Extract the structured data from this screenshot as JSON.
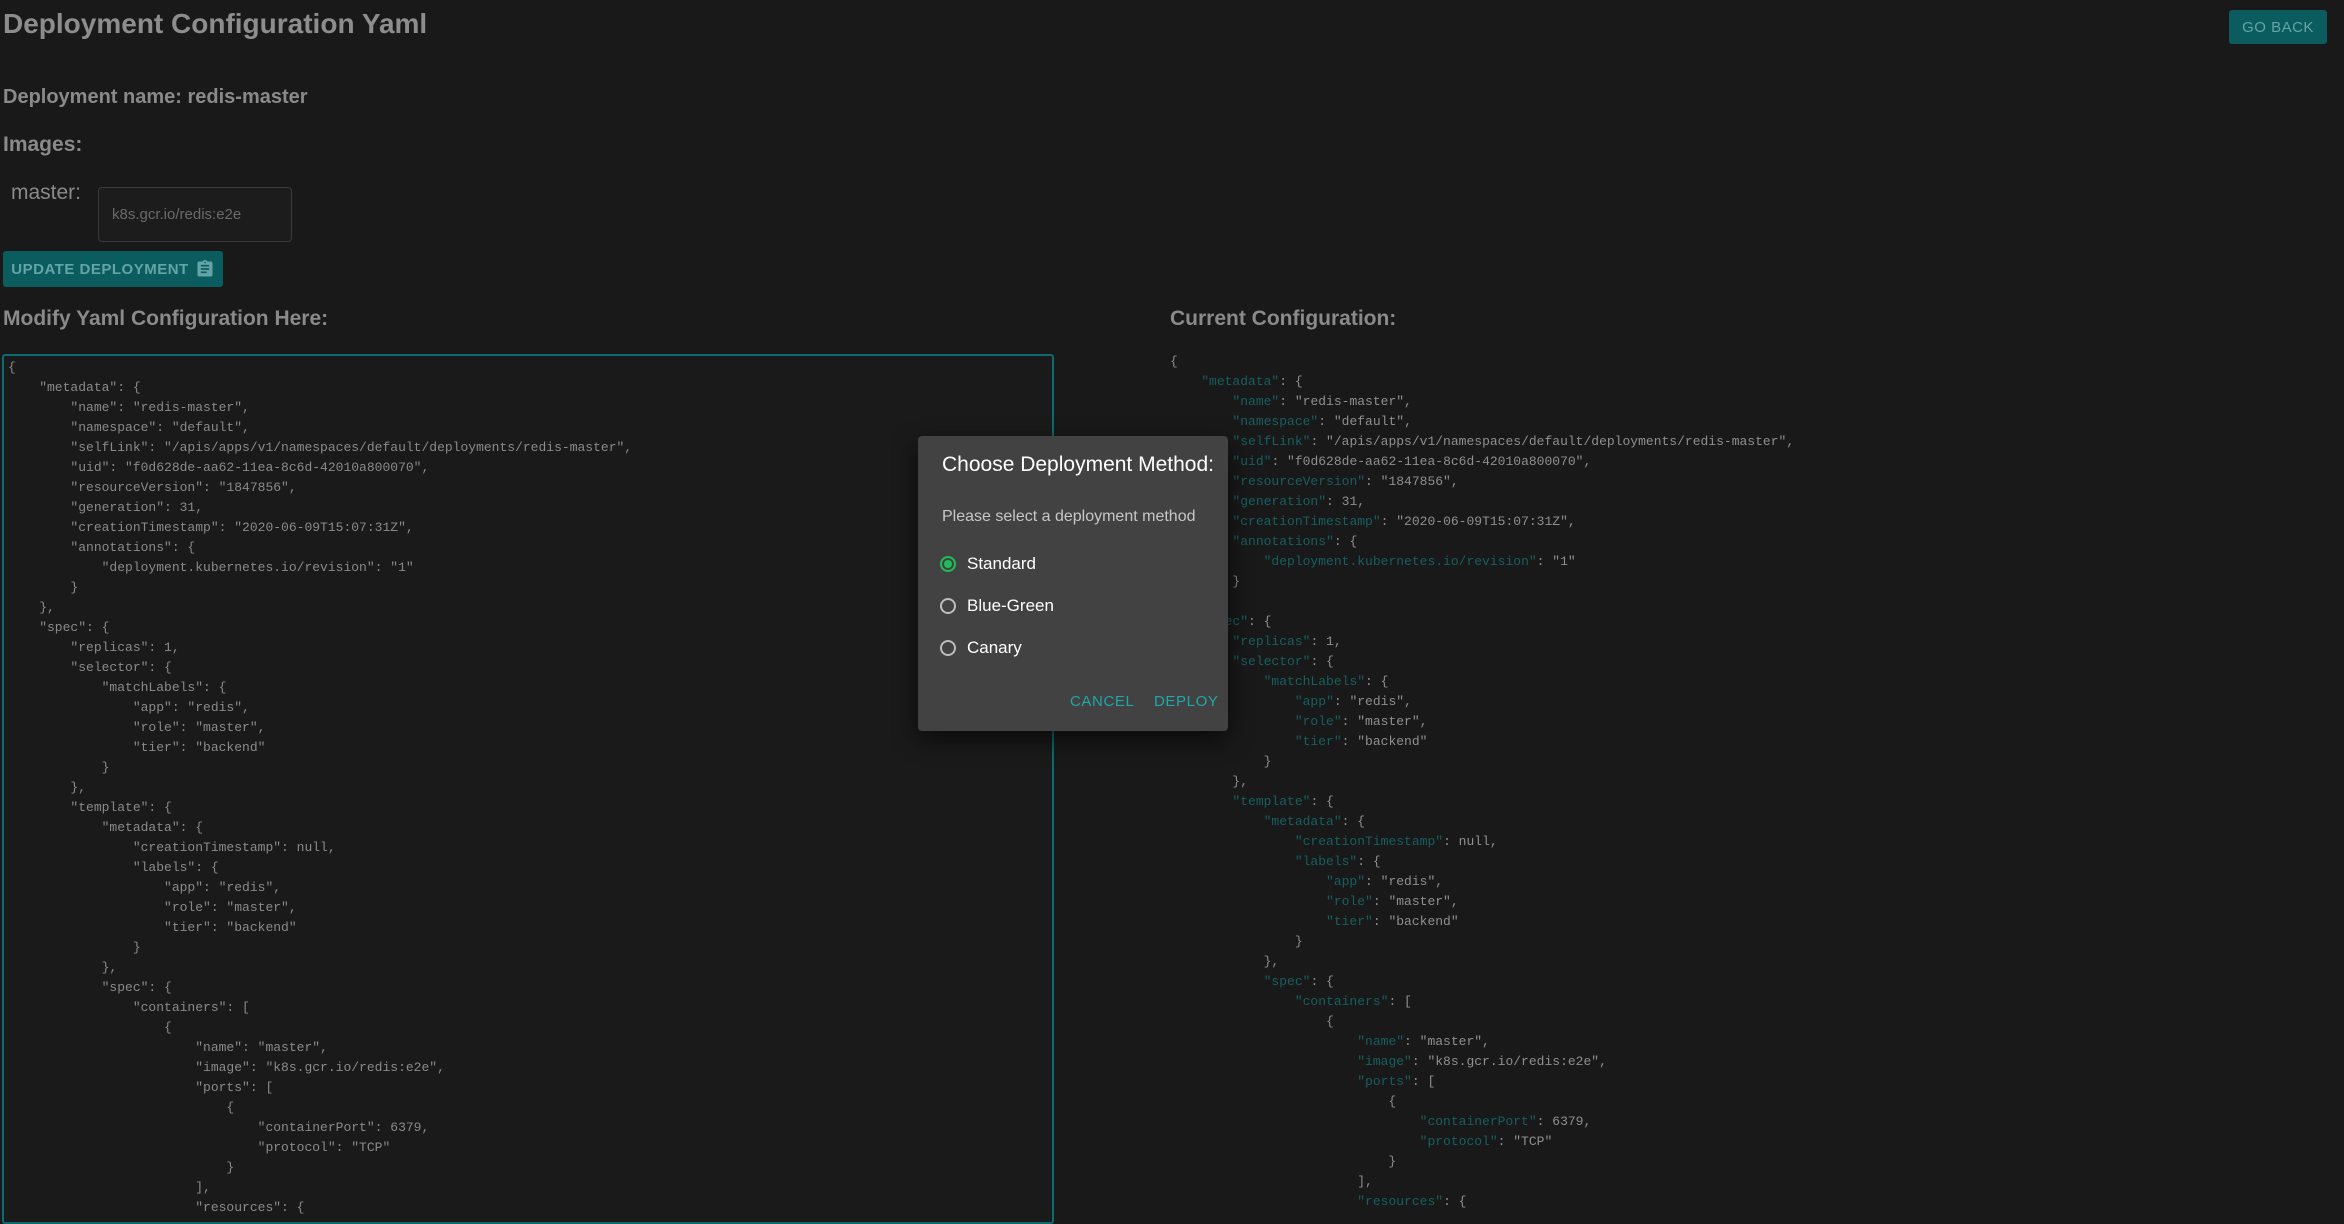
{
  "header": {
    "title": "Deployment Configuration Yaml",
    "go_back_label": "GO BACK"
  },
  "deployment": {
    "name_line": "Deployment name: redis-master",
    "images_heading": "Images:"
  },
  "image_field": {
    "label": "master:",
    "value": "k8s.gcr.io/redis:e2e"
  },
  "update_button": {
    "label": "UPDATE DEPLOYMENT",
    "icon": "clipboard-icon"
  },
  "editor": {
    "heading": "Modify Yaml Configuration Here:"
  },
  "current": {
    "heading": "Current Configuration:"
  },
  "yaml_lines": [
    "{",
    "    \"metadata\": {",
    "        \"name\": \"redis-master\",",
    "        \"namespace\": \"default\",",
    "        \"selfLink\": \"/apis/apps/v1/namespaces/default/deployments/redis-master\",",
    "        \"uid\": \"f0d628de-aa62-11ea-8c6d-42010a800070\",",
    "        \"resourceVersion\": \"1847856\",",
    "        \"generation\": 31,",
    "        \"creationTimestamp\": \"2020-06-09T15:07:31Z\",",
    "        \"annotations\": {",
    "            \"deployment.kubernetes.io/revision\": \"1\"",
    "        }",
    "    },",
    "    \"spec\": {",
    "        \"replicas\": 1,",
    "        \"selector\": {",
    "            \"matchLabels\": {",
    "                \"app\": \"redis\",",
    "                \"role\": \"master\",",
    "                \"tier\": \"backend\"",
    "            }",
    "        },",
    "        \"template\": {",
    "            \"metadata\": {",
    "                \"creationTimestamp\": null,",
    "                \"labels\": {",
    "                    \"app\": \"redis\",",
    "                    \"role\": \"master\",",
    "                    \"tier\": \"backend\"",
    "                }",
    "            },",
    "            \"spec\": {",
    "                \"containers\": [",
    "                    {",
    "                        \"name\": \"master\",",
    "                        \"image\": \"k8s.gcr.io/redis:e2e\",",
    "                        \"ports\": [",
    "                            {",
    "                                \"containerPort\": 6379,",
    "                                \"protocol\": \"TCP\"",
    "                            }",
    "                        ],",
    "                        \"resources\": {"
  ],
  "dialog": {
    "title": "Choose Deployment Method:",
    "prompt": "Please select a deployment method",
    "options": [
      {
        "label": "Standard",
        "selected": true
      },
      {
        "label": "Blue-Green",
        "selected": false
      },
      {
        "label": "Canary",
        "selected": false
      }
    ],
    "cancel_label": "CANCEL",
    "deploy_label": "DEPLOY",
    "accent_color": "#1fbd5b"
  },
  "colors": {
    "accent": "#0b5c5e",
    "key_color": "#175f61"
  }
}
